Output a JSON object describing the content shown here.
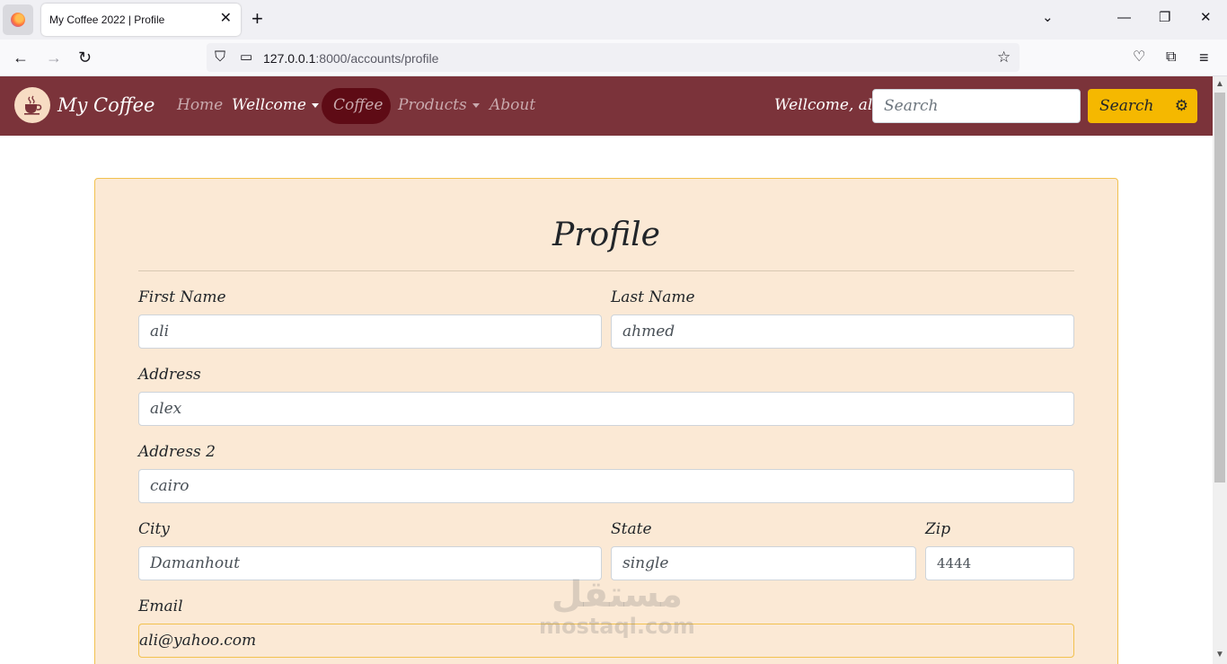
{
  "browser": {
    "tab_title": "My Coffee 2022 | Profile",
    "url_host": "127.0.0.1",
    "url_rest": ":8000/accounts/profile"
  },
  "site": {
    "brand": "My Coffee",
    "nav": [
      {
        "label": "Home"
      },
      {
        "label": "Wellcome"
      },
      {
        "label": "Coffee"
      },
      {
        "label": "Products"
      },
      {
        "label": "About"
      }
    ],
    "welcome_text": "Wellcome, ali",
    "search_placeholder": "Search",
    "search_button": "Search"
  },
  "profile": {
    "title": "Profile",
    "first_name_label": "First Name",
    "first_name": "ali",
    "last_name_label": "Last Name",
    "last_name": "ahmed",
    "address_label": "Address",
    "address": "alex",
    "address2_label": "Address 2",
    "address2": "cairo",
    "city_label": "City",
    "city": "Damanhout",
    "state_label": "State",
    "state": "single",
    "zip_label": "Zip",
    "zip": "4444",
    "email_label": "Email",
    "email": "ali@yahoo.com"
  },
  "watermark": {
    "arabic": "مستقل",
    "latin": "mostaql.com"
  }
}
